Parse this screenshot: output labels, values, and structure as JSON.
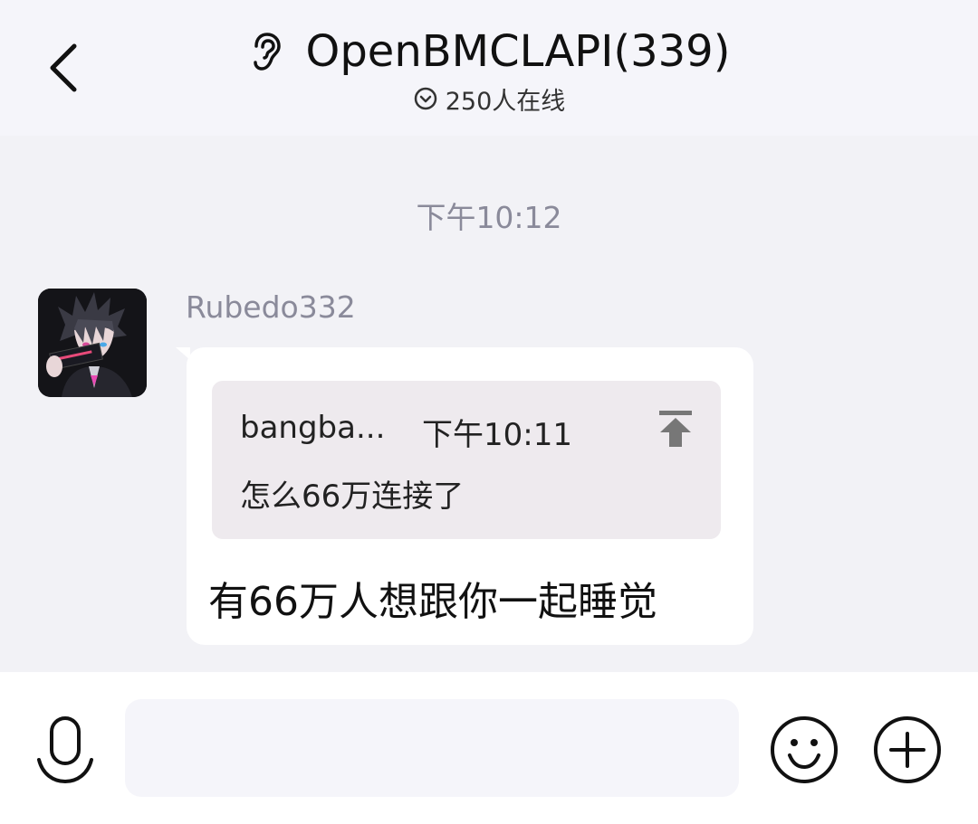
{
  "header": {
    "title": "OpenBMCLAPI(339)",
    "online_status": "250人在线",
    "back_icon": "chevron-left-icon",
    "title_icon": "ear-icon",
    "online_icon": "chevron-down-circle-icon"
  },
  "chat": {
    "timestamp": "下午10:12",
    "messages": [
      {
        "sender": "Rubedo332",
        "avatar_icon": "avatar-image",
        "quote": {
          "author": "bangba...",
          "time": "下午10:11",
          "text": "怎么66万连接了",
          "jump_icon": "jump-to-top-icon"
        },
        "text": "有66万人想跟你一起睡觉"
      }
    ]
  },
  "input_bar": {
    "voice_icon": "microphone-icon",
    "input_value": "",
    "emoji_icon": "emoji-icon",
    "plus_icon": "plus-circle-icon"
  },
  "colors": {
    "header_bg": "#f5f5fa",
    "chat_bg": "#f2f2f6",
    "bubble_bg": "#ffffff",
    "quote_bg": "#eeeaee",
    "muted_text": "#8a8a9a"
  }
}
